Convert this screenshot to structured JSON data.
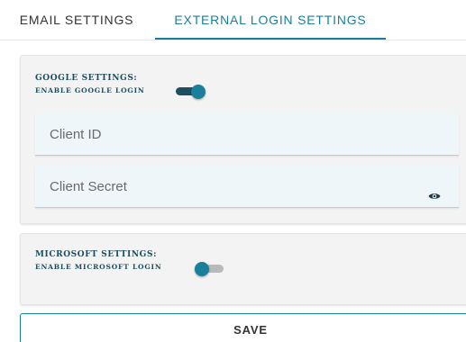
{
  "tabs": {
    "email": "EMAIL SETTINGS",
    "external": "EXTERNAL LOGIN SETTINGS",
    "active": "external"
  },
  "google": {
    "title": "GOOGLE SETTINGS:",
    "enable_label": "ENABLE GOOGLE LOGIN",
    "enabled": true,
    "client_id_placeholder": "Client ID",
    "client_id_value": "",
    "client_secret_placeholder": "Client Secret",
    "client_secret_value": ""
  },
  "microsoft": {
    "title": "MICROSOFT SETTINGS:",
    "enable_label": "ENABLE MICROSOFT LOGIN",
    "enabled": false
  },
  "actions": {
    "save_label": "SAVE"
  },
  "colors": {
    "accent": "#1a7f9c",
    "heading": "#1e4d5e",
    "panel_bg": "#f3f3f3",
    "field_bg": "#eef6fa"
  },
  "icons": {
    "secret_visibility": "eye-icon"
  }
}
